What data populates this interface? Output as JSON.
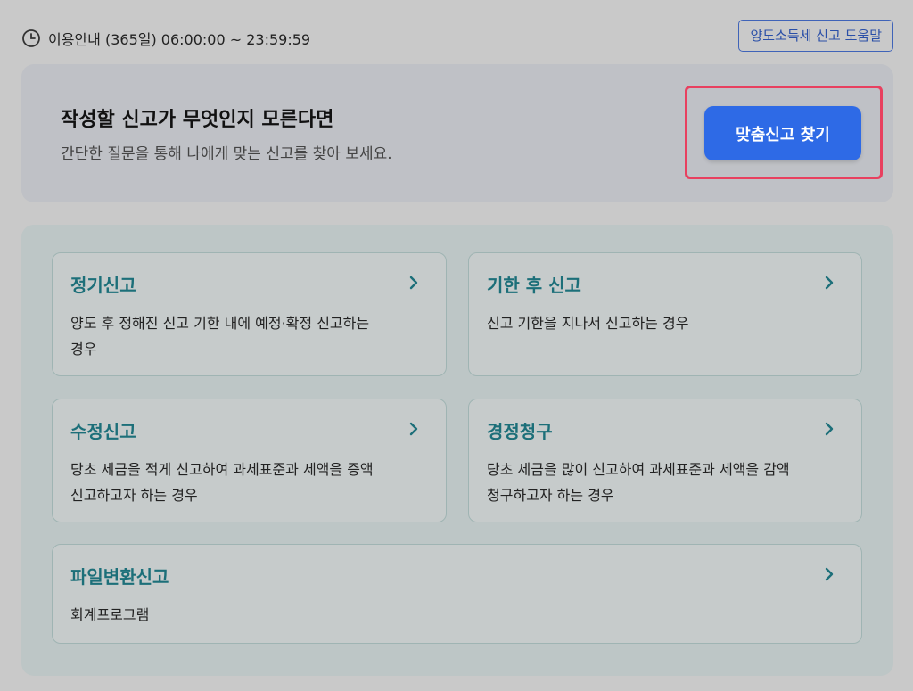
{
  "hours": {
    "icon": "clock-icon",
    "text": "이용안내 (365일) 06:00:00 ~ 23:59:59"
  },
  "help_button": {
    "label": "양도소득세 신고 도움말"
  },
  "finder": {
    "title": "작성할 신고가 무엇인지 모른다면",
    "subtitle": "간단한 질문을 통해 나에게 맞는 신고를 찾아 보세요.",
    "button_label": "맞춤신고 찾기",
    "button_color": "#2e6ae6",
    "highlight_color": "#e8405f"
  },
  "report_types": [
    {
      "title": "정기신고",
      "desc_lines": [
        "양도 후 정해진 신고 기한 내에 예정·확정 신고하는",
        "경우"
      ],
      "icon": "chevron-right-icon"
    },
    {
      "title": "기한 후 신고",
      "desc_lines": [
        "신고 기한을 지나서 신고하는 경우"
      ],
      "icon": "chevron-right-icon"
    },
    {
      "title": "수정신고",
      "desc_lines": [
        "당초 세금을 적게 신고하여 과세표준과 세액을 증액",
        "신고하고자 하는 경우"
      ],
      "icon": "chevron-right-icon"
    },
    {
      "title": "경정청구",
      "desc_lines": [
        "당초 세금을 많이 신고하여 과세표준과 세액을 감액",
        "청구하고자 하는 경우"
      ],
      "icon": "chevron-right-icon"
    },
    {
      "title": "파일변환신고",
      "desc_lines": [
        "회계프로그램"
      ],
      "icon": "chevron-right-icon"
    }
  ],
  "title_color": "#1c6f79"
}
